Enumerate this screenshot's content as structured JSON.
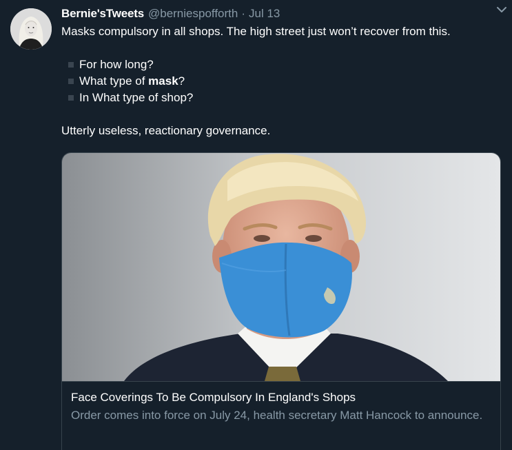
{
  "tweet": {
    "display_name": "Bernie'sTweets",
    "handle": "@berniespofforth",
    "separator": "·",
    "date": "Jul 13",
    "line1": "Masks compulsory in all shops. The high street just won’t recover from this.",
    "bullets": [
      {
        "text": "For how long?"
      },
      {
        "pre": "What type of ",
        "bold": "mask",
        "post": "?"
      },
      {
        "text": "In What type of shop?"
      }
    ],
    "closing": "Utterly useless, reactionary governance."
  },
  "card": {
    "title": "Face Coverings To Be Compulsory In England's Shops",
    "description": "Order comes into force on July 24, health secretary Matt Hancock to announce.",
    "image_icon": "photo-man-in-blue-face-mask"
  },
  "colors": {
    "background": "#15202b",
    "secondary_text": "#8899a6",
    "border": "#38444d",
    "mask_blue": "#3a8fd6"
  },
  "icons": {
    "menu": "chevron-down-icon"
  }
}
